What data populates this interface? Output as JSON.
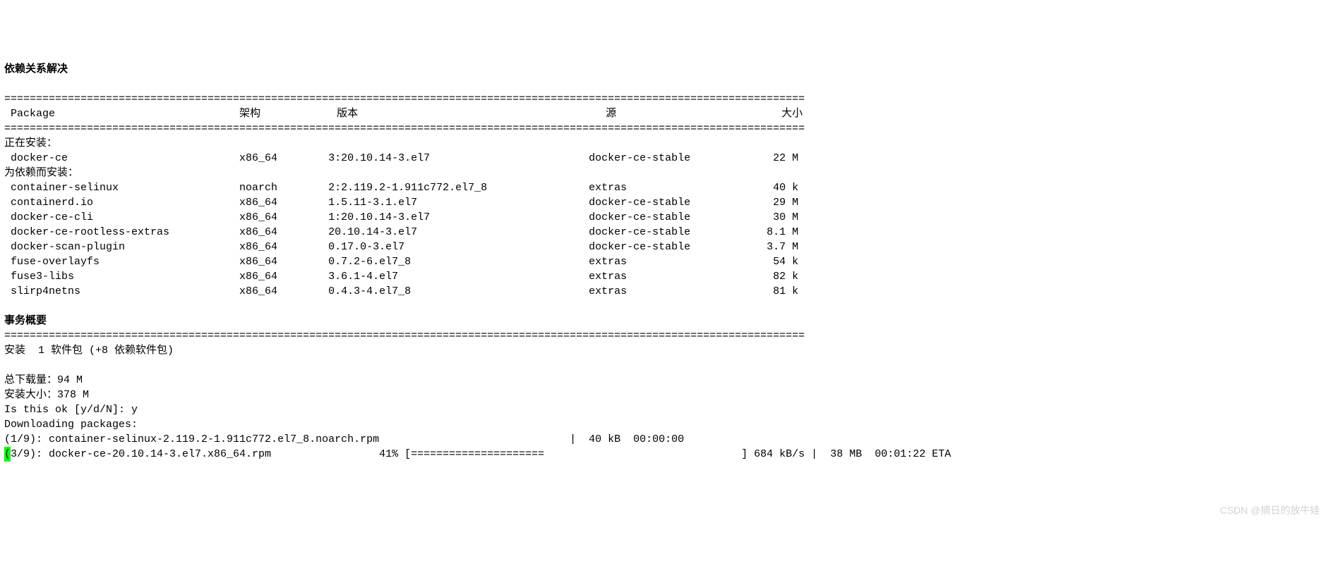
{
  "lines": {
    "resolving": "依赖关系解决",
    "rule": "==============================================================================================================================",
    "headers": {
      "package": " Package",
      "arch": "架构",
      "version": "版本",
      "repo": "源",
      "size": "大小"
    },
    "installing": "正在安装：",
    "installing_deps": "为依赖而安装：",
    "transaction_summary": "事务概要",
    "install_summary": "安装  1 软件包 (+8 依赖软件包)",
    "total_download": "总下载量：94 M",
    "installed_size": "安装大小：378 M",
    "prompt": "Is this ok [y/d/N]: y",
    "downloading": "Downloading packages:"
  },
  "packages": {
    "main": [
      {
        "name": " docker-ce",
        "arch": "x86_64",
        "version": "3:20.10.14-3.el7",
        "repo": "docker-ce-stable",
        "size": " 22 M"
      }
    ],
    "deps": [
      {
        "name": " container-selinux",
        "arch": "noarch",
        "version": "2:2.119.2-1.911c772.el7_8",
        "repo": "extras",
        "size": " 40 k"
      },
      {
        "name": " containerd.io",
        "arch": "x86_64",
        "version": "1.5.11-3.1.el7",
        "repo": "docker-ce-stable",
        "size": " 29 M"
      },
      {
        "name": " docker-ce-cli",
        "arch": "x86_64",
        "version": "1:20.10.14-3.el7",
        "repo": "docker-ce-stable",
        "size": " 30 M"
      },
      {
        "name": " docker-ce-rootless-extras",
        "arch": "x86_64",
        "version": "20.10.14-3.el7",
        "repo": "docker-ce-stable",
        "size": "8.1 M"
      },
      {
        "name": " docker-scan-plugin",
        "arch": "x86_64",
        "version": "0.17.0-3.el7",
        "repo": "docker-ce-stable",
        "size": "3.7 M"
      },
      {
        "name": " fuse-overlayfs",
        "arch": "x86_64",
        "version": "0.7.2-6.el7_8",
        "repo": "extras",
        "size": " 54 k"
      },
      {
        "name": " fuse3-libs",
        "arch": "x86_64",
        "version": "3.6.1-4.el7",
        "repo": "extras",
        "size": " 82 k"
      },
      {
        "name": " slirp4netns",
        "arch": "x86_64",
        "version": "0.4.3-4.el7_8",
        "repo": "extras",
        "size": " 81 k"
      }
    ]
  },
  "downloads": {
    "done_line": "(1/9): container-selinux-2.119.2-1.911c772.el7_8.noarch.rpm                              |  40 kB  00:00:00",
    "progress": {
      "index": "3/9",
      "file": "docker-ce-20.10.14-3.el7.x86_64.rpm",
      "percent": "41%",
      "bar": "[=====================                               ]",
      "rate": "684 kB/s",
      "sep1": " | ",
      "size": " 38 MB",
      "sep2": "  ",
      "eta": "00:01:22 ETA"
    }
  },
  "watermark": "CSDN @摘日的放牛娃"
}
